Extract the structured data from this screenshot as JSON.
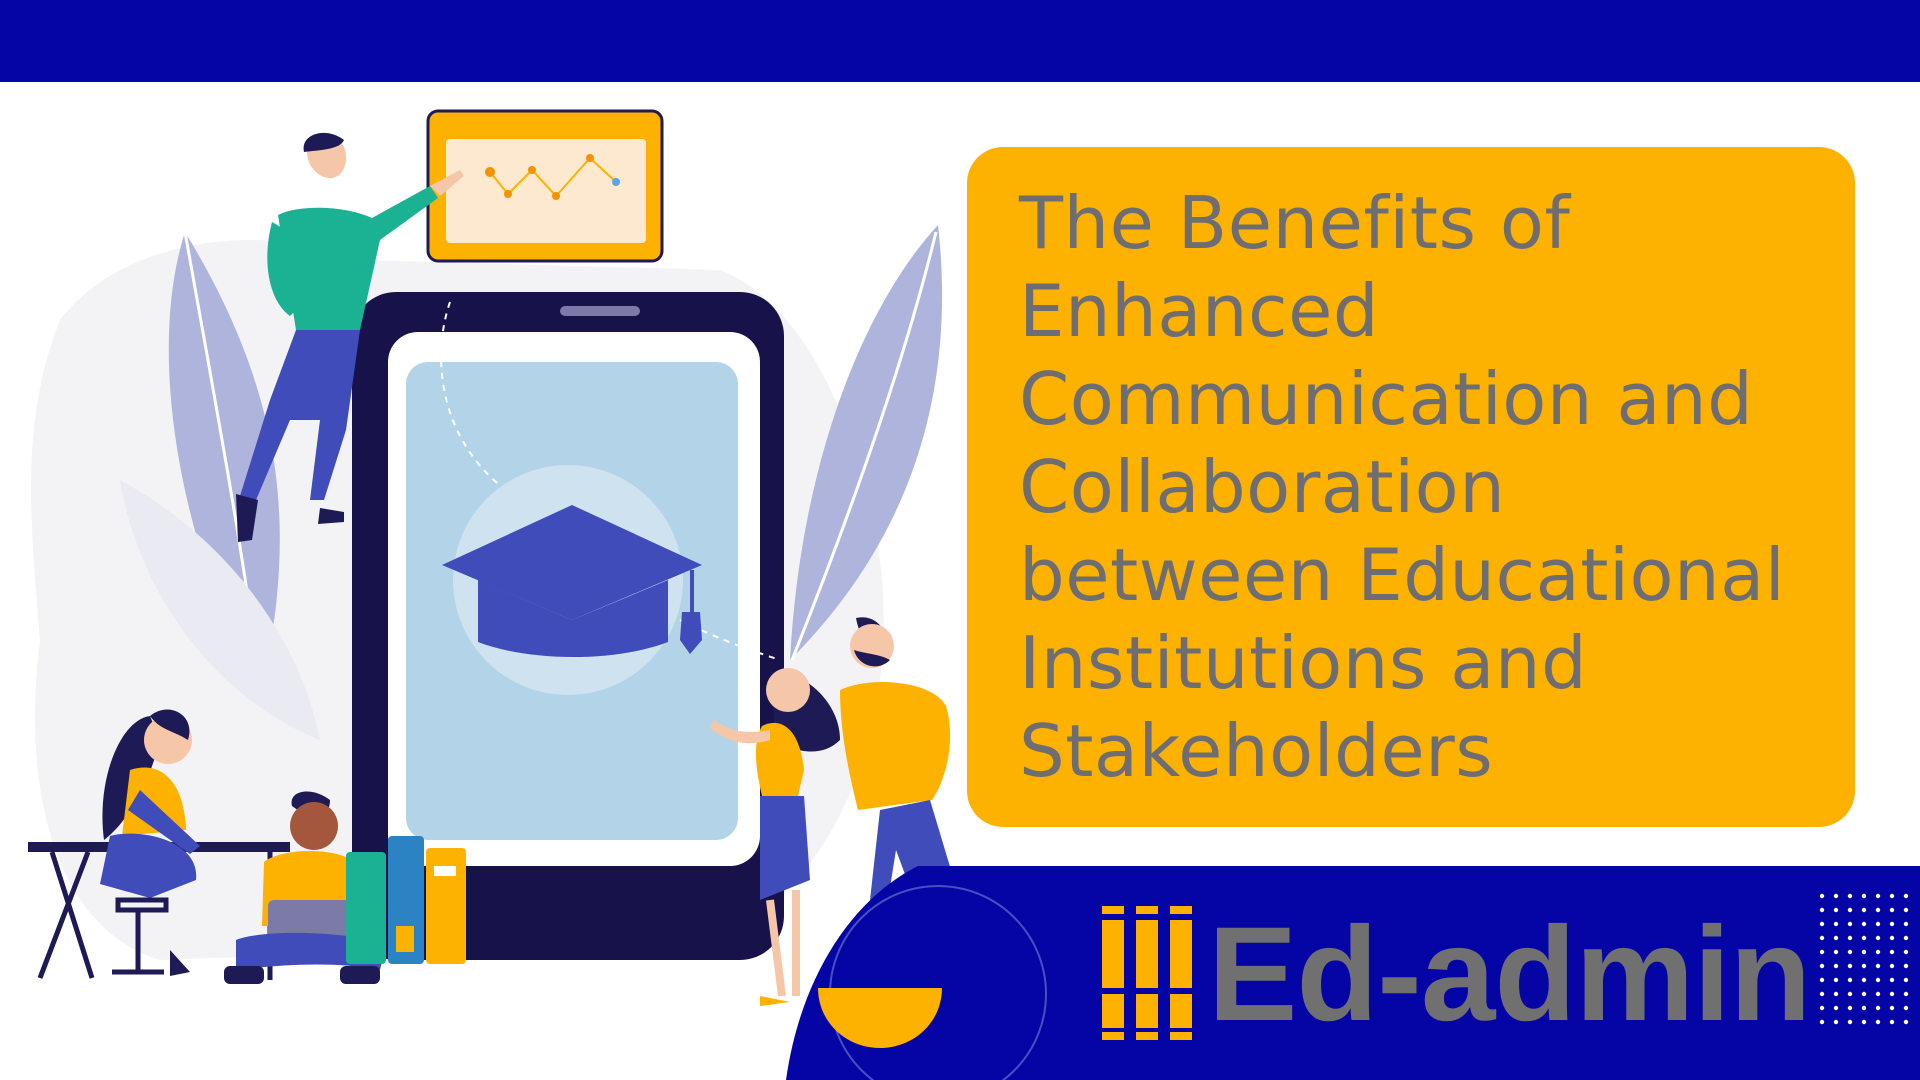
{
  "title": "The Benefits of Enhanced Communication and Collaboration between Educational Institutions and Stakeholders",
  "brand": {
    "name": "Ed-admin",
    "logo_icon": "bookshelf-icon"
  },
  "illustration": {
    "center_icon": "graduation-cap-icon",
    "board_icon": "line-chart-icon"
  },
  "colors": {
    "navy": "#0505a5",
    "orange": "#fdb100",
    "title_text": "#6e6e72",
    "logo_text": "#707070"
  }
}
